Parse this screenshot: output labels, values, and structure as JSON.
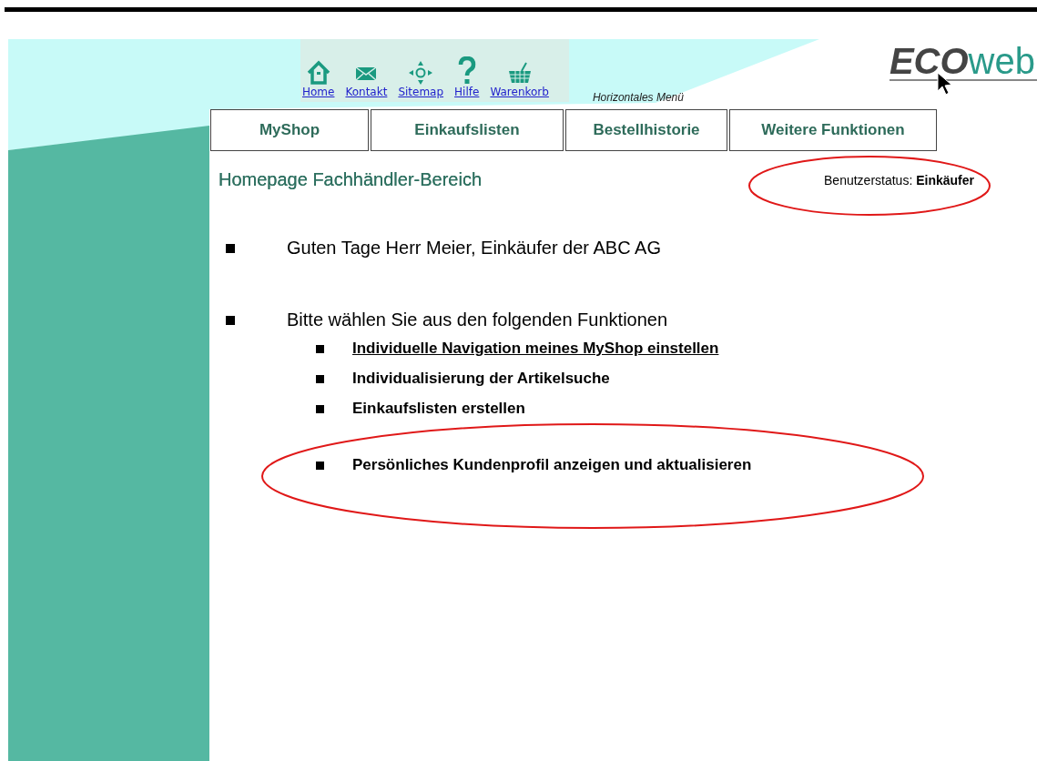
{
  "nav": [
    {
      "kind": "home",
      "label": "Home"
    },
    {
      "kind": "mail",
      "label": "Kontakt"
    },
    {
      "kind": "sitemap",
      "label": "Sitemap"
    },
    {
      "kind": "help",
      "label": "Hilfe"
    },
    {
      "kind": "basket",
      "label": "Warenkorb"
    }
  ],
  "nav_caption": "Horizontales Menü",
  "logo": {
    "first": "ECO",
    "second": "web"
  },
  "tabs": [
    {
      "label": "MyShop"
    },
    {
      "label": "Einkaufslisten"
    },
    {
      "label": "Bestellhistorie"
    },
    {
      "label": "Weitere Funktionen"
    }
  ],
  "heading": "Homepage Fachhändler-Bereich",
  "user_status": "Benutzerstatus: **Einkäufer**",
  "items": [
    {
      "label": "Guten Tage Herr Meier, Einkäufer der ABC AG"
    },
    {
      "label": "Bitte wählen Sie aus den folgenden Funktionen",
      "children": [
        {
          "kind": "link",
          "label": "Individuelle Navigation meines MyShop einstellen"
        },
        {
          "kind": "text",
          "label": "Individualisierung der Artikelsuche"
        },
        {
          "kind": "text",
          "label": "Einkaufslisten erstellen"
        },
        {
          "kind": "text",
          "label": "Persönliches Kundenprofil anzeigen und aktualisieren"
        }
      ]
    }
  ]
}
